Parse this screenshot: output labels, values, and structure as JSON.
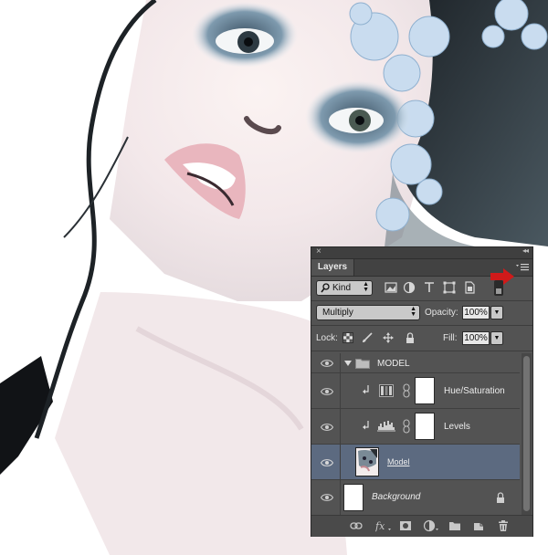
{
  "panel": {
    "close_glyph": "×",
    "collapse_glyph": "◂◂",
    "tab_label": "Layers",
    "filter": {
      "kind_label": "Kind",
      "icons": [
        "pixel-filter-icon",
        "adjustment-filter-icon",
        "type-filter-icon",
        "shape-filter-icon",
        "smart-object-filter-icon"
      ]
    },
    "blend_mode": "Multiply",
    "opacity_label": "Opacity:",
    "opacity_value": "100%",
    "lock_label": "Lock:",
    "fill_label": "Fill:",
    "fill_value": "100%",
    "layers": [
      {
        "name": "MODEL",
        "type": "group",
        "expanded": true
      },
      {
        "name": "Hue/Saturation",
        "type": "adjustment",
        "clipped": true
      },
      {
        "name": "Levels",
        "type": "adjustment",
        "clipped": true
      },
      {
        "name": "Model",
        "type": "pixel",
        "selected": true
      },
      {
        "name": "Background",
        "type": "background",
        "locked": true
      }
    ],
    "footer_icons": [
      "link-layers-icon",
      "fx-icon",
      "add-mask-icon",
      "new-adjustment-icon",
      "new-group-icon",
      "new-layer-icon",
      "trash-icon"
    ],
    "colors": {
      "panel_bg": "#535353",
      "selected_row": "#5c6a80",
      "arrow": "#d11a1a"
    }
  }
}
